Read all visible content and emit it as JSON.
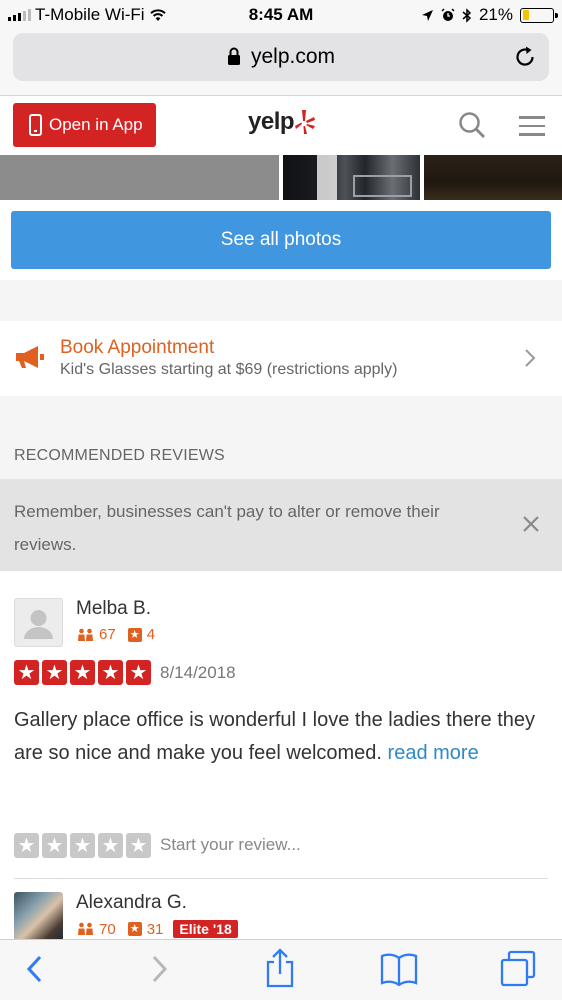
{
  "status_bar": {
    "carrier": "T-Mobile Wi-Fi",
    "time": "8:45 AM",
    "battery": "21%"
  },
  "browser": {
    "url": "yelp.com"
  },
  "header": {
    "open_in_app": "Open in App",
    "logo": "yelp"
  },
  "photos": {
    "see_all": "See all photos"
  },
  "booking": {
    "title": "Book Appointment",
    "subtitle": "Kid's Glasses starting at $69 (restrictions apply)"
  },
  "reviews": {
    "section_title": "RECOMMENDED REVIEWS",
    "notice": "Remember, businesses can't pay to alter or remove their reviews.",
    "items": [
      {
        "user": "Melba B.",
        "friends": "67",
        "review_count": "4",
        "rating": 5,
        "date": "8/14/2018",
        "text": "Gallery place office is wonderful I love the ladies there they are so nice and make you feel welcomed.",
        "read_more": "read more"
      },
      {
        "user": "Alexandra G.",
        "friends": "70",
        "review_count": "31",
        "elite": "Elite '18"
      }
    ],
    "start_review": "Start your review..."
  },
  "colors": {
    "yelp_red": "#d32323",
    "link_blue": "#2c8ac6",
    "button_blue": "#4196e0",
    "orange": "#e0601f"
  }
}
